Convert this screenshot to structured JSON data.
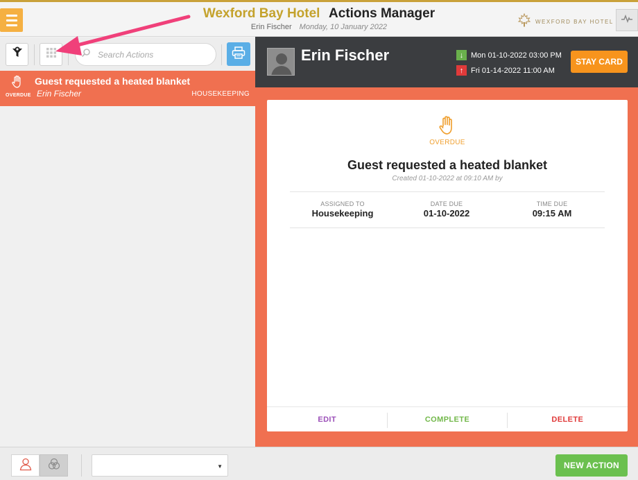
{
  "header": {
    "hotel_name": "Wexford Bay Hotel",
    "app_title": "Actions Manager",
    "user_name": "Erin Fischer",
    "date": "Monday, 10 January 2022",
    "brand_text": "WEXFORD BAY HOTEL"
  },
  "toolbar": {
    "search_placeholder": "Search Actions"
  },
  "list": {
    "items": [
      {
        "status": "OVERDUE",
        "title": "Guest requested a heated blanket",
        "guest": "Erin Fischer",
        "department": "HOUSEKEEPING"
      }
    ]
  },
  "guest": {
    "name": "Erin Fischer",
    "arrival": "Mon 01-10-2022  03:00 PM",
    "departure": "Fri 01-14-2022  11:00 AM",
    "stay_card_label": "STAY CARD"
  },
  "detail": {
    "status": "OVERDUE",
    "title": "Guest requested a heated blanket",
    "created": "Created 01-10-2022 at 09:10 AM by",
    "assigned_label": "ASSIGNED TO",
    "assigned_value": "Housekeeping",
    "date_due_label": "DATE DUE",
    "date_due_value": "01-10-2022",
    "time_due_label": "TIME DUE",
    "time_due_value": "09:15 AM",
    "edit_label": "EDIT",
    "complete_label": "COMPLETE",
    "delete_label": "DELETE"
  },
  "footer": {
    "select_value": "",
    "new_action_label": "NEW ACTION"
  },
  "colors": {
    "accent_gold": "#c4a22c",
    "menu_orange": "#f5b042",
    "overdue_coral": "#f07050",
    "stay_card_orange": "#f7941d",
    "new_action_green": "#6bc04f",
    "print_blue": "#5aaee6",
    "annotation_pink": "#f0407a"
  }
}
